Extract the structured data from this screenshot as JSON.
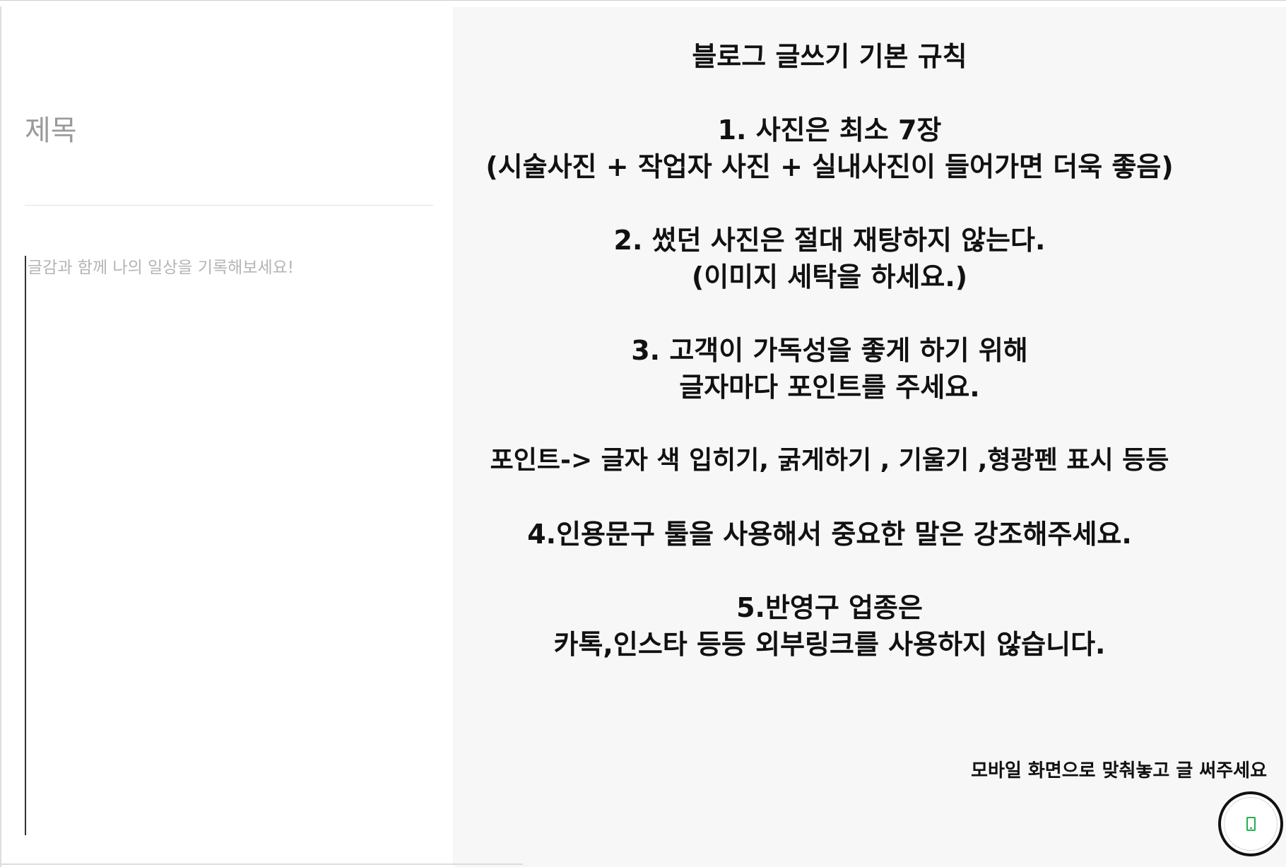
{
  "editor": {
    "title_placeholder": "제목",
    "body_placeholder": "글감과 함께 나의 일상을 기록해보세요!"
  },
  "guide": {
    "lines": [
      "블로그 글쓰기 기본 규칙",
      "",
      "1. 사진은 최소 7장",
      "(시술사진 + 작업자 사진 + 실내사진이 들어가면 더욱 좋음)",
      "",
      "2. 썼던 사진은 절대 재탕하지 않는다.",
      "(이미지 세탁을 하세요.)",
      "",
      "3. 고객이 가독성을 좋게 하기 위해",
      "글자마다 포인트를 주세요.",
      "",
      "포인트-> 글자 색 입히기, 굵게하기 , 기울기 ,형광펜 표시 등등",
      "",
      "4.인용문구 툴을 사용해서 중요한 말은 강조해주세요.",
      "",
      "5.반영구 업종은",
      "카톡,인스타 등등 외부링크를 사용하지 않습니다."
    ],
    "note": "모바일 화면으로 맞춰놓고 글 써주세요"
  },
  "mobile_button": {
    "icon": "mobile-phone-icon",
    "color": "#22b14c"
  }
}
